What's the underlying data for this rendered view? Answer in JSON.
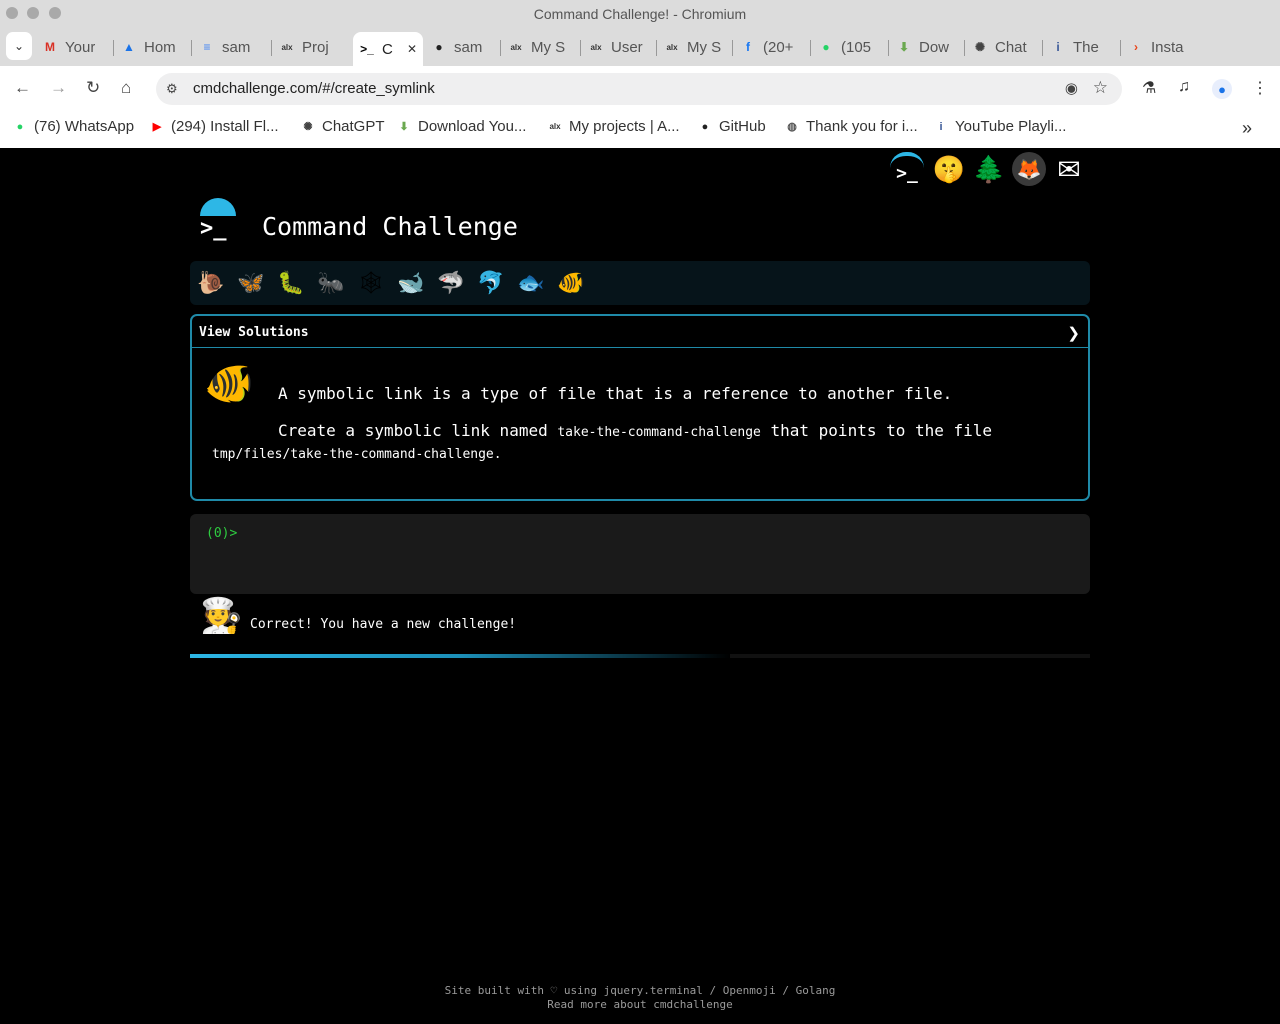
{
  "window": {
    "title": "Command Challenge! - Chromium"
  },
  "tabs": [
    {
      "label": "Your",
      "icon": "gmail-icon",
      "color": "#d93025",
      "glyph": "M"
    },
    {
      "label": "Hom",
      "icon": "google-drive-icon",
      "color": "#1a73e8",
      "glyph": "▲"
    },
    {
      "label": "sam",
      "icon": "google-docs-icon",
      "color": "#4285f4",
      "glyph": "≡"
    },
    {
      "label": "Proj",
      "icon": "alx-icon",
      "color": "#333333",
      "glyph": "alx"
    },
    {
      "label": "C",
      "icon": "terminal-icon",
      "color": "#000000",
      "glyph": ">_",
      "active": true
    },
    {
      "label": "sam",
      "icon": "github-icon",
      "color": "#222222",
      "glyph": "●"
    },
    {
      "label": "My S",
      "icon": "alx-icon",
      "color": "#333333",
      "glyph": "alx"
    },
    {
      "label": "User",
      "icon": "alx-icon",
      "color": "#333333",
      "glyph": "alx"
    },
    {
      "label": "My S",
      "icon": "alx-icon",
      "color": "#333333",
      "glyph": "alx"
    },
    {
      "label": "(20+",
      "icon": "facebook-icon",
      "color": "#1877f2",
      "glyph": "f"
    },
    {
      "label": "(105",
      "icon": "whatsapp-icon",
      "color": "#25d366",
      "glyph": "●"
    },
    {
      "label": "Dow",
      "icon": "download-icon",
      "color": "#6aa84f",
      "glyph": "⬇"
    },
    {
      "label": "Chat",
      "icon": "chatgpt-icon",
      "color": "#444444",
      "glyph": "✺"
    },
    {
      "label": "The",
      "icon": "info-icon",
      "color": "#3b5998",
      "glyph": "i"
    },
    {
      "label": "Insta",
      "icon": "instapy-icon",
      "color": "#e8441a",
      "glyph": "›"
    }
  ],
  "toolbar": {
    "url": "cmdchallenge.com/#/create_symlink"
  },
  "bookmarks": [
    {
      "label": "(76) WhatsApp",
      "icon": "whatsapp-icon",
      "color": "#25d366",
      "glyph": "●"
    },
    {
      "label": "(294) Install Fl...",
      "icon": "youtube-icon",
      "color": "#ff0000",
      "glyph": "▶"
    },
    {
      "label": "ChatGPT",
      "icon": "chatgpt-icon",
      "color": "#444444",
      "glyph": "✺"
    },
    {
      "label": "Download You...",
      "icon": "download-icon",
      "color": "#6aa84f",
      "glyph": "⬇"
    },
    {
      "label": "My projects | A...",
      "icon": "alx-icon",
      "color": "#333333",
      "glyph": "alx"
    },
    {
      "label": "GitHub",
      "icon": "github-icon",
      "color": "#222222",
      "glyph": "●"
    },
    {
      "label": "Thank you for i...",
      "icon": "globe-icon",
      "color": "#555555",
      "glyph": "◍"
    },
    {
      "label": "YouTube Playli...",
      "icon": "info-icon",
      "color": "#3b5998",
      "glyph": "i"
    }
  ],
  "page": {
    "title": "Command Challenge",
    "top_icons": [
      {
        "name": "terminal-icon",
        "glyph": ">_"
      },
      {
        "name": "shushing-face-icon",
        "glyph": "🤫"
      },
      {
        "name": "tree-icon",
        "glyph": "🌲"
      },
      {
        "name": "gitlab-icon",
        "glyph": "🦊"
      },
      {
        "name": "envelope-icon",
        "glyph": "✉"
      }
    ],
    "levels": [
      {
        "name": "snail-icon",
        "glyph": "🐌"
      },
      {
        "name": "butterfly-icon",
        "glyph": "🦋"
      },
      {
        "name": "caterpillar-icon",
        "glyph": "🐛"
      },
      {
        "name": "ant-icon",
        "glyph": "🐜"
      },
      {
        "name": "web-icon",
        "glyph": "🕸"
      },
      {
        "name": "whale-icon",
        "glyph": "🐋"
      },
      {
        "name": "shark-icon",
        "glyph": "🦈"
      },
      {
        "name": "dolphin-icon",
        "glyph": "🐬"
      },
      {
        "name": "fish-icon",
        "glyph": "🐟"
      },
      {
        "name": "tropical-fish-icon",
        "glyph": "🐠"
      }
    ],
    "panel": {
      "header": "View Solutions",
      "chevron": "❯",
      "description": "A symbolic link is a type of file that is a reference to another file.",
      "task_prefix": "Create a symbolic link named",
      "task_link_name": "take-the-command-challenge",
      "task_suffix": "that points to the file",
      "task_target": "tmp/files/take-the-command-challenge."
    },
    "terminal": {
      "prompt": "(0)>"
    },
    "message": "Correct! You have a new challenge!",
    "progress": 0.6,
    "footer_line1": "Site built with ♡ using jquery.terminal / Openmoji / Golang",
    "footer_line2": "Read more about cmdchallenge"
  }
}
